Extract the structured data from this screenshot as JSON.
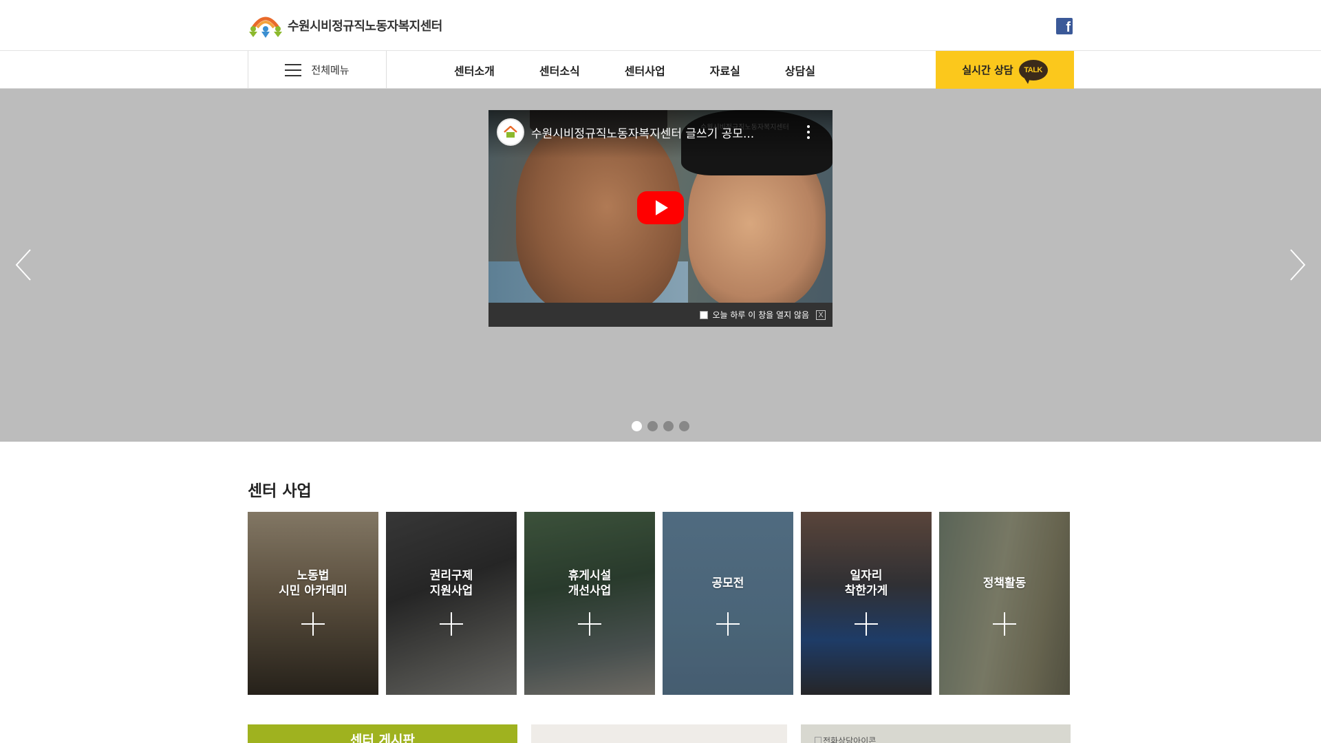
{
  "header": {
    "site_name": "수원시비정규직노동자복지센터",
    "facebook_icon": "facebook-icon"
  },
  "nav": {
    "all_menu_label": "전체메뉴",
    "items": [
      {
        "label": "센터소개"
      },
      {
        "label": "센터소식"
      },
      {
        "label": "센터사업"
      },
      {
        "label": "자료실"
      },
      {
        "label": "상담실"
      }
    ],
    "talk_button_label": "실시간 상담",
    "talk_badge": "TALK",
    "talk_color": "#fbc81c"
  },
  "hero": {
    "video_title": "수원시비정규직노동자복지센터 글쓰기 공모...",
    "watermark": "수원시비정규직노동자복지센터",
    "popup_dismiss_label": "오늘 하루 이 창을 열지 않음",
    "popup_close_label": "X",
    "slides": 4,
    "active_slide": 1
  },
  "business": {
    "title": "센터 사업",
    "cards": [
      {
        "label": "노동법\n시민 아카데미"
      },
      {
        "label": "권리구제\n지원사업"
      },
      {
        "label": "휴게시설\n개선사업"
      },
      {
        "label": "공모전"
      },
      {
        "label": "일자리\n착한가게"
      },
      {
        "label": "정책활동"
      }
    ]
  },
  "bottom": {
    "board_title": "센터 게시판",
    "board_color": "#9fb21f",
    "phone_image_alt": "전화상담아이콘"
  }
}
